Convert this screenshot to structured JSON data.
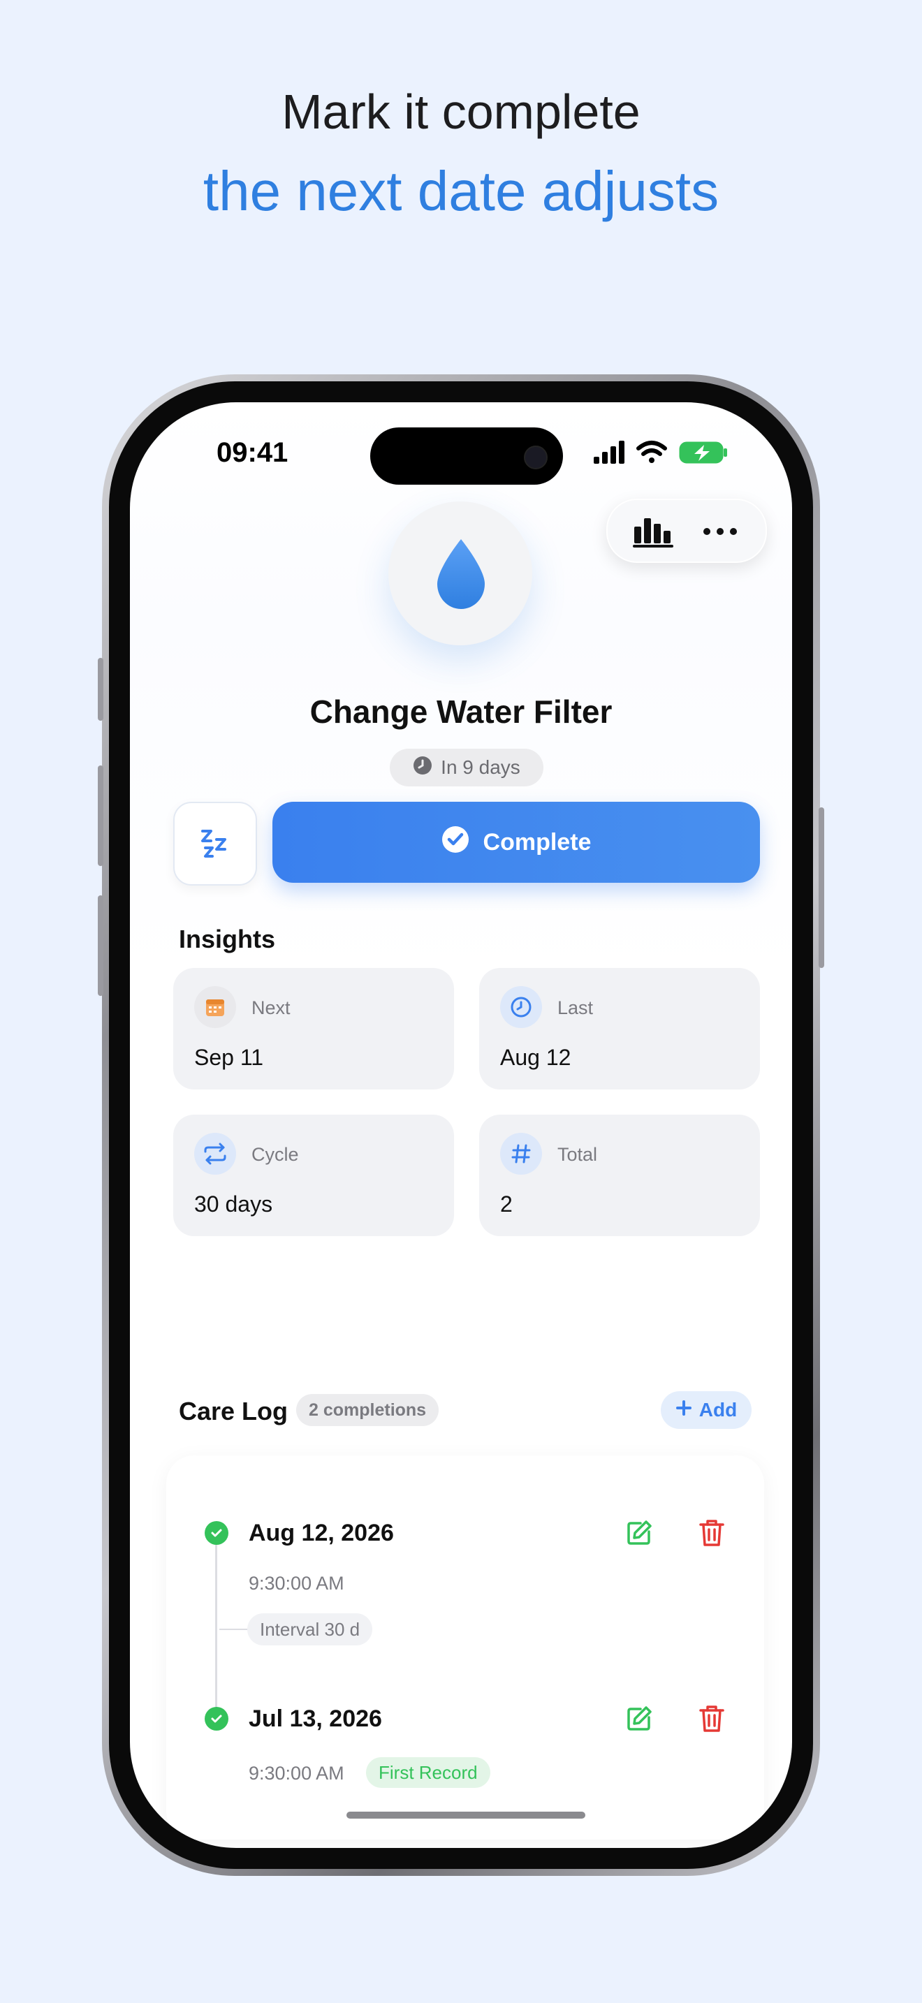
{
  "promo": {
    "headline": "Mark it complete",
    "subheadline": "the next date adjusts"
  },
  "status_bar": {
    "time": "09:41"
  },
  "reminder": {
    "title": "Change Water Filter",
    "due": "In 9 days",
    "complete_label": "Complete"
  },
  "insights": {
    "title": "Insights",
    "cards": [
      {
        "label": "Next",
        "value": "Sep 11",
        "icon": "calendar-icon"
      },
      {
        "label": "Last",
        "value": "Aug 12",
        "icon": "clock-icon"
      },
      {
        "label": "Cycle",
        "value": "30 days",
        "icon": "repeat-icon"
      },
      {
        "label": "Total",
        "value": "2",
        "icon": "hash-icon"
      }
    ]
  },
  "care_log": {
    "title": "Care Log",
    "count": "2 completions",
    "add_label": "Add",
    "interval": "Interval 30 d",
    "entries": [
      {
        "date": "Aug 12, 2026",
        "time": "9:30:00 AM"
      },
      {
        "date": "Jul 13, 2026",
        "time": "9:30:00 AM",
        "badge": "First Record"
      }
    ]
  },
  "colors": {
    "accent": "#3A80EE",
    "success": "#34C25A",
    "danger": "#E53935",
    "background": "#EBF2FE"
  }
}
